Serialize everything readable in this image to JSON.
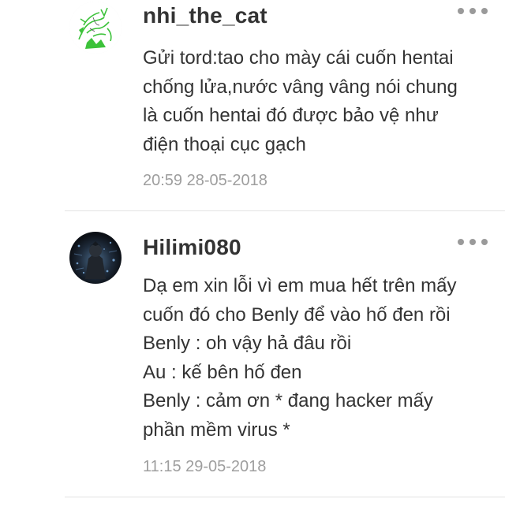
{
  "comments": [
    {
      "username": "nhi_the_cat",
      "avatar_icon": "sketch-avatar-icon",
      "lines": [
        "Gửi tord:tao cho mày cái cuốn hentai",
        "chống lửa,nước vâng vâng nói chung",
        "là cuốn hentai đó được bảo vệ như",
        "điện thoại cục gạch"
      ],
      "timestamp": "20:59 28-05-2018"
    },
    {
      "username": "Hilimi080",
      "avatar_icon": "dark-character-avatar-icon",
      "lines": [
        "Dạ em xin lỗi vì em mua hết trên mấy",
        "cuốn đó cho Benly để vào hố đen rồi",
        "Benly : oh vậy hả đâu rồi",
        "Au : kế bên hố đen",
        "Benly : cảm ơn * đang hacker mấy",
        "phần mềm virus *"
      ],
      "timestamp": "11:15 29-05-2018"
    }
  ],
  "colors": {
    "text": "#333333",
    "timestamp": "#9e9e9e",
    "more_dots": "#9a9a9a",
    "divider": "#e2e2e2",
    "avatar_accent_green": "#3cc23a"
  }
}
